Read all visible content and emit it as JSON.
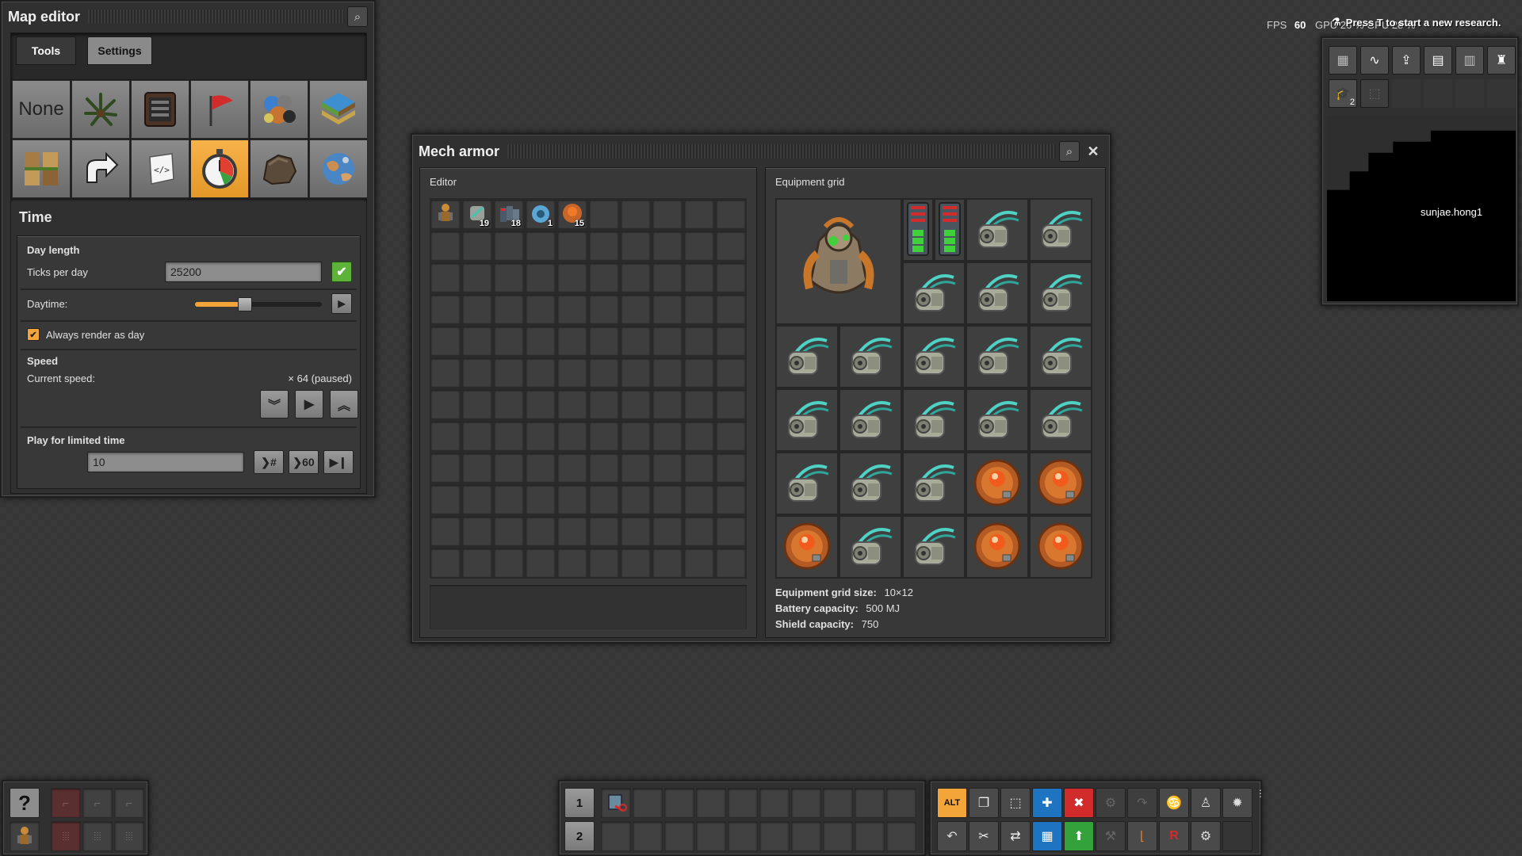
{
  "map_editor": {
    "title": "Map editor",
    "tabs": [
      "Tools",
      "Settings"
    ],
    "tools": [
      {
        "label": "None",
        "icon": "none-text"
      },
      {
        "label": "",
        "icon": "tree-icon"
      },
      {
        "label": "",
        "icon": "decoratives-icon"
      },
      {
        "label": "",
        "icon": "force-flag-icon"
      },
      {
        "label": "",
        "icon": "resources-icon"
      },
      {
        "label": "",
        "icon": "tiles-icon"
      },
      {
        "label": "",
        "icon": "surfaces-icon"
      },
      {
        "label": "",
        "icon": "cliff-icon"
      },
      {
        "label": "",
        "icon": "script-icon"
      },
      {
        "label": "",
        "icon": "time-icon"
      },
      {
        "label": "",
        "icon": "rock-icon"
      },
      {
        "label": "",
        "icon": "planet-icon"
      }
    ],
    "section_title": "Time",
    "day_length": {
      "heading": "Day length",
      "ticks_label": "Ticks per day",
      "ticks_value": "25200"
    },
    "daytime": {
      "label": "Daytime:",
      "level": 0.4
    },
    "always_render": {
      "label": "Always render as day",
      "checked": true
    },
    "speed": {
      "heading": "Speed",
      "current_label": "Current speed:",
      "current_value": "× 64 (paused)"
    },
    "limited": {
      "heading": "Play for limited time",
      "value": "10",
      "btn_hash": "❯#",
      "btn_60": "❯60"
    }
  },
  "mech_armor": {
    "title": "Mech armor",
    "editor_label": "Editor",
    "inventory": [
      {
        "icon": "mech-armor-icon",
        "count": ""
      },
      {
        "icon": "exoskeleton-icon",
        "count": "19"
      },
      {
        "icon": "battery-mk3-icon",
        "count": "18"
      },
      {
        "icon": "personal-roboport-icon",
        "count": "1"
      },
      {
        "icon": "energy-shield-icon",
        "count": "15"
      }
    ],
    "equipment_label": "Equipment grid",
    "grid_size_label": "Equipment grid size:",
    "grid_size_value": "10×12",
    "battery_label": "Battery capacity:",
    "battery_value": "500 MJ",
    "shield_label": "Shield capacity:",
    "shield_value": "750"
  },
  "hud": {
    "fps_label": "FPS",
    "fps_value": "60",
    "gpu_text": "GPU 26 % GPU 28 %",
    "research_text": "Press T to start a new research.",
    "player_name": "sunjae.hong1",
    "research_badge": "2"
  },
  "toolbar": {
    "row_numbers": [
      "1",
      "2"
    ],
    "alt_label": "ALT"
  },
  "colors": {
    "accent": "#f3a53a",
    "confirm": "#5cb338",
    "blue": "#1f74c2",
    "red": "#d22b2b",
    "green": "#34a23a"
  }
}
